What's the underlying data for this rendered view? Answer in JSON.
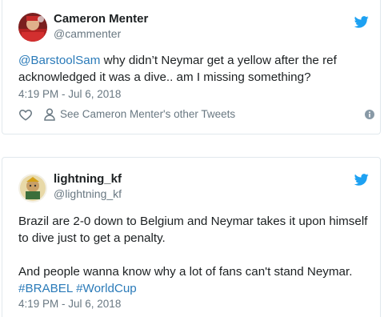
{
  "tweets": [
    {
      "author_name": "Cameron Menter",
      "author_handle": "@cammenter",
      "body_mention": "@BarstoolSam",
      "body_text": " why didn’t Neymar get a yellow after the ref acknowledged it was a dive.. am I missing something?",
      "timestamp": "4:19 PM - Jul 6, 2018",
      "other_tweets_label": "See Cameron Menter's other Tweets",
      "icons": [
        "heart-icon",
        "person-icon",
        "info-icon",
        "twitter-bird-icon"
      ]
    },
    {
      "author_name": "lightning_kf",
      "author_handle": "@lightning_kf",
      "body_line1": "Brazil are 2-0 down to Belgium and Neymar takes it upon himself to dive just to get a penalty.",
      "body_line2": "And people wanna know why a lot of fans can't stand Neymar.",
      "hashtag1": "#BRABEL",
      "hashtag2": "#WorldCup",
      "timestamp": "4:19 PM - Jul 6, 2018",
      "icons": [
        "twitter-bird-icon"
      ]
    }
  ],
  "colors": {
    "link": "#2b7bb9",
    "muted": "#697882",
    "text": "#1c2022",
    "border": "#e1e8ed",
    "twitter_blue": "#1da1f2"
  }
}
